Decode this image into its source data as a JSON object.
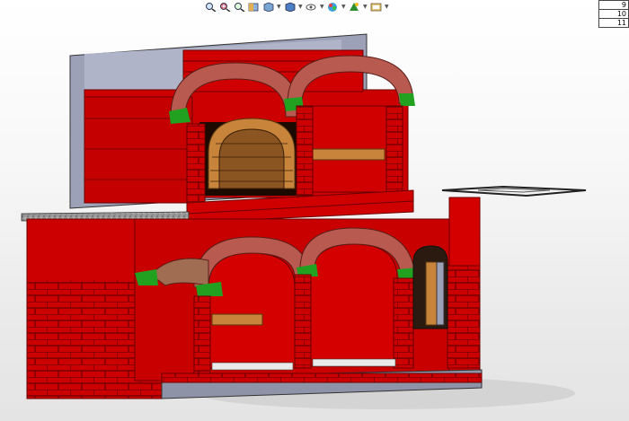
{
  "window": {
    "background": "#f0f0f0"
  },
  "toolbar": {
    "buttons": [
      {
        "icon": "zoom-to-fit-icon"
      },
      {
        "icon": "zoom-to-area-icon"
      },
      {
        "icon": "previous-view-icon"
      },
      {
        "icon": "section-view-icon"
      },
      {
        "icon": "view-orientation-icon"
      },
      {
        "icon": "display-style-icon"
      },
      {
        "icon": "hide-show-items-icon"
      },
      {
        "icon": "edit-appearance-icon"
      },
      {
        "icon": "apply-scene-icon"
      },
      {
        "icon": "view-settings-icon"
      }
    ]
  },
  "table": {
    "rows": [
      "9",
      "10",
      "11"
    ]
  },
  "model": {
    "colors": {
      "brick": "#cc0000",
      "brick_mortar": "#7a0000",
      "arch_brick": "#b85a50",
      "green_keystone": "#22a020",
      "wood": "#c8843a",
      "granite_top": "#8a8a8a",
      "grey_back": "#9da1b8",
      "base_slab": "#8f93a8"
    }
  }
}
